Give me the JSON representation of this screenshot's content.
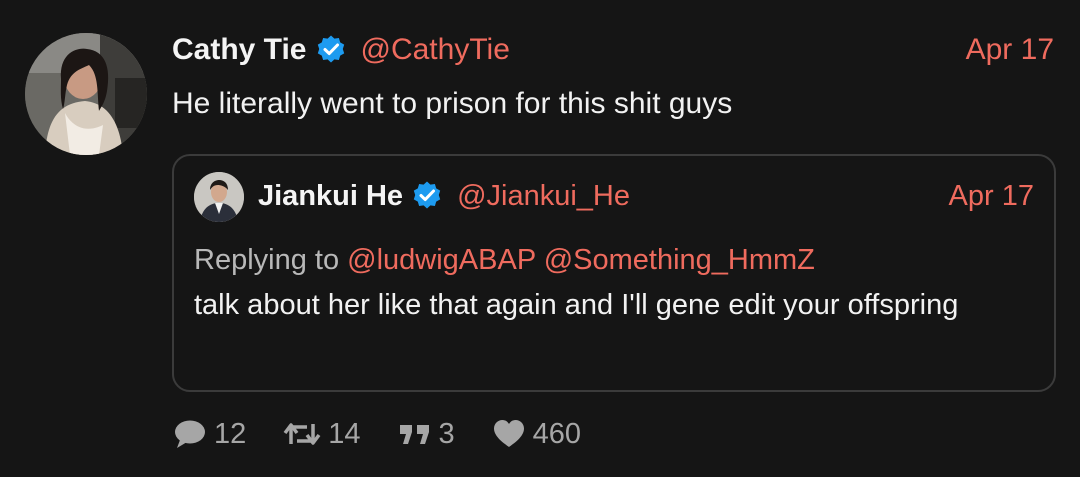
{
  "tweet": {
    "author_name": "Cathy Tie",
    "author_handle": "@CathyTie",
    "date": "Apr 17",
    "text": "He literally went to prison for this shit guys",
    "verified": true
  },
  "quoted": {
    "author_name": "Jiankui He",
    "author_handle": "@Jiankui_He",
    "date": "Apr 17",
    "verified": true,
    "replying_prefix": "Replying to",
    "reply_mentions": [
      "@ludwigABAP",
      "@Something_HmmZ"
    ],
    "text": "talk about her like that again and I'll gene edit your offspring"
  },
  "actions": {
    "replies": "12",
    "retweets": "14",
    "quotes": "3",
    "likes": "460"
  },
  "colors": {
    "background": "#151515",
    "accent": "#ef6b5e",
    "verified_badge": "#1d9bf0",
    "muted": "#a6a6a6"
  },
  "icons": [
    "verified-icon",
    "reply-icon",
    "retweet-icon",
    "quote-icon",
    "like-icon"
  ]
}
